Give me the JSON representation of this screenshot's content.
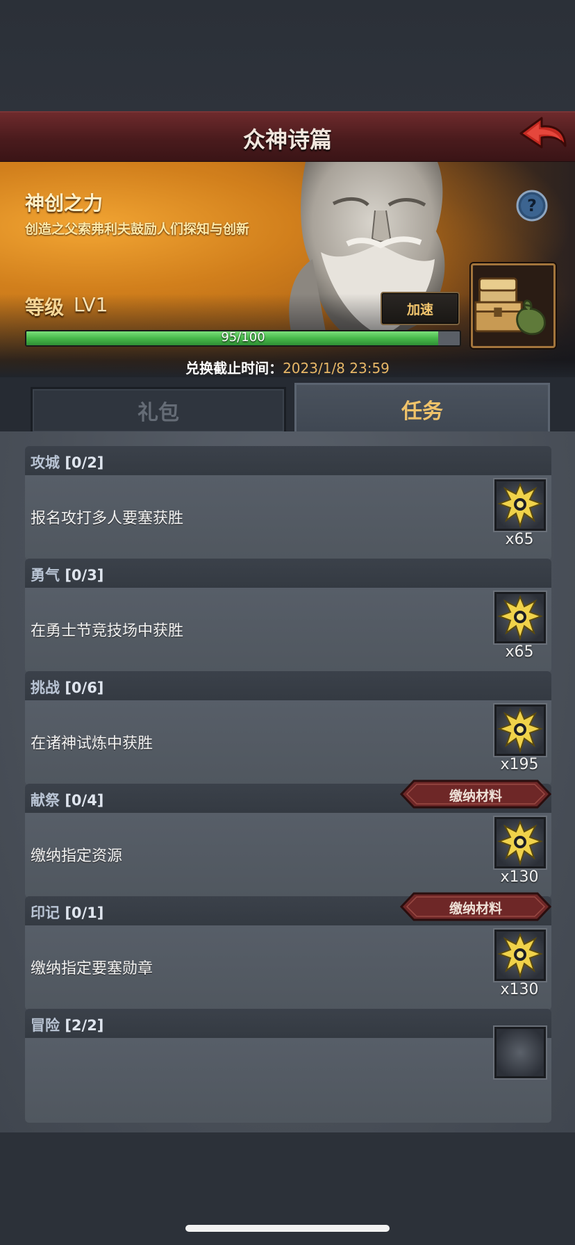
{
  "header": {
    "title": "众神诗篇"
  },
  "banner": {
    "title": "神创之力",
    "subtitle": "创造之父索弗利夫鼓励人们探知与创新",
    "level_label": "等级",
    "level_value": "LV1",
    "speed_button": "加速",
    "progress_text": "95/100",
    "progress_fraction": 0.95,
    "deadline_label": "兑换截止时间：",
    "deadline_value": "2023/1/8 23:59"
  },
  "tabs": [
    {
      "label": "礼包",
      "active": false
    },
    {
      "label": "任务",
      "active": true
    }
  ],
  "tasks": [
    {
      "name": "攻城",
      "progress": "[0/2]",
      "desc": "报名攻打多人要塞获胜",
      "reward": "x65"
    },
    {
      "name": "勇气",
      "progress": "[0/3]",
      "desc": "在勇士节竞技场中获胜",
      "reward": "x65"
    },
    {
      "name": "挑战",
      "progress": "[0/6]",
      "desc": "在诸神试炼中获胜",
      "reward": "x195"
    },
    {
      "name": "献祭",
      "progress": "[0/4]",
      "desc": "缴纳指定资源",
      "reward": "x130",
      "button": "缴纳材料"
    },
    {
      "name": "印记",
      "progress": "[0/1]",
      "desc": "缴纳指定要塞勋章",
      "reward": "x130",
      "button": "缴纳材料"
    },
    {
      "name": "冒险",
      "progress": "[2/2]",
      "desc": "",
      "reward": ""
    }
  ]
}
